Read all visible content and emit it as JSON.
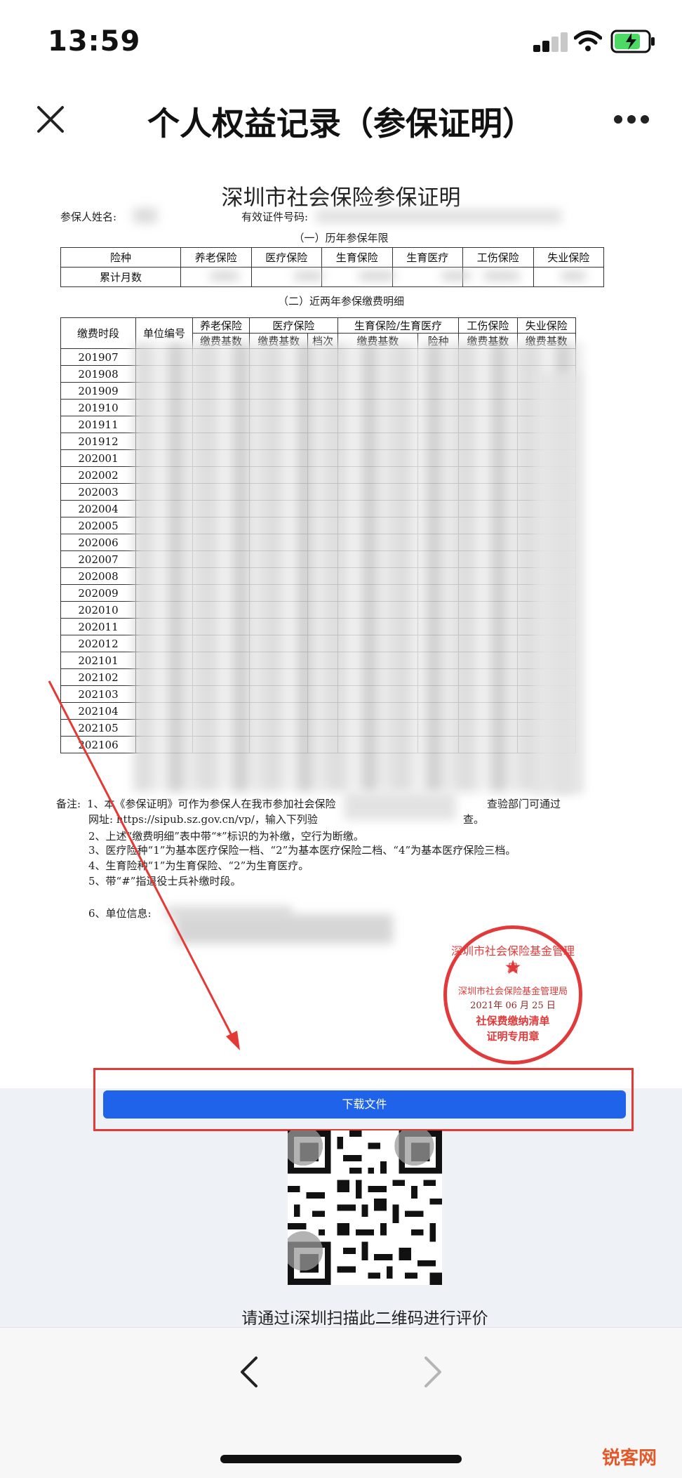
{
  "status_bar": {
    "time": "13:59"
  },
  "nav": {
    "title": "个人权益记录（参保证明）"
  },
  "document": {
    "title": "深圳市社会保险参保证明",
    "insured_name_label": "参保人姓名:",
    "id_label": "有效证件号码:",
    "section1": "（一）历年参保年限",
    "table1": {
      "headers": [
        "险种",
        "养老保险",
        "医疗保险",
        "生育保险",
        "生育医疗",
        "工伤保险",
        "失业保险"
      ],
      "row_label": "累计月数"
    },
    "section2": "（二）近两年参保缴费明细",
    "table2": {
      "col_period": "缴费时段",
      "col_unit": "单位编号",
      "groups": [
        "养老保险",
        "医疗保险",
        "生育保险/生育医疗",
        "工伤保险",
        "失业保险"
      ],
      "subheaders": [
        "缴费基数",
        "缴费基数",
        "档次",
        "缴费基数",
        "险种",
        "缴费基数",
        "缴费基数"
      ],
      "periods": [
        "201907",
        "201908",
        "201909",
        "201910",
        "201911",
        "201912",
        "202001",
        "202002",
        "202003",
        "202004",
        "202005",
        "202006",
        "202007",
        "202008",
        "202009",
        "202010",
        "202011",
        "202012",
        "202101",
        "202102",
        "202103",
        "202104",
        "202105",
        "202106"
      ]
    },
    "notes": {
      "label": "备注:",
      "line1": "1、本《参保证明》可作为参保人在我市参加社会保险",
      "line1b": "查验部门可通过",
      "line2": "网址: https://sipub.sz.gov.cn/vp/，输入下列验",
      "line2b": "查。",
      "line3": "2、上述“缴费明细”表中带“*”标识的为补缴，空行为断缴。",
      "line4": "3、医疗险种“1”为基本医疗保险一档、“2”为基本医疗保险二档、“4”为基本医疗保险三档。",
      "line5": "4、生育险种“1”为生育保险、“2”为生育医疗。",
      "line6": "5、带“#”指退役士兵补缴时段。",
      "line7": "6、单位信息:"
    },
    "stamp": {
      "ring": "深圳市社会保险基金管理局",
      "issuer": "深圳市社会保险基金管理局",
      "date": "2021年 06 月 25 日",
      "line1": "社保费缴纳清单",
      "line2": "证明专用章"
    }
  },
  "actions": {
    "download_label": "下载文件"
  },
  "qr_caption": "请通过i深圳扫描此二维码进行评价",
  "watermark": "锐客网",
  "colors": {
    "accent": "#1e63e9",
    "stamp": "#e23a3a",
    "annotation": "#e53935"
  },
  "icons": {
    "close": "close-icon",
    "more": "more-icon",
    "back": "chevron-left-icon",
    "forward": "chevron-right-icon"
  }
}
